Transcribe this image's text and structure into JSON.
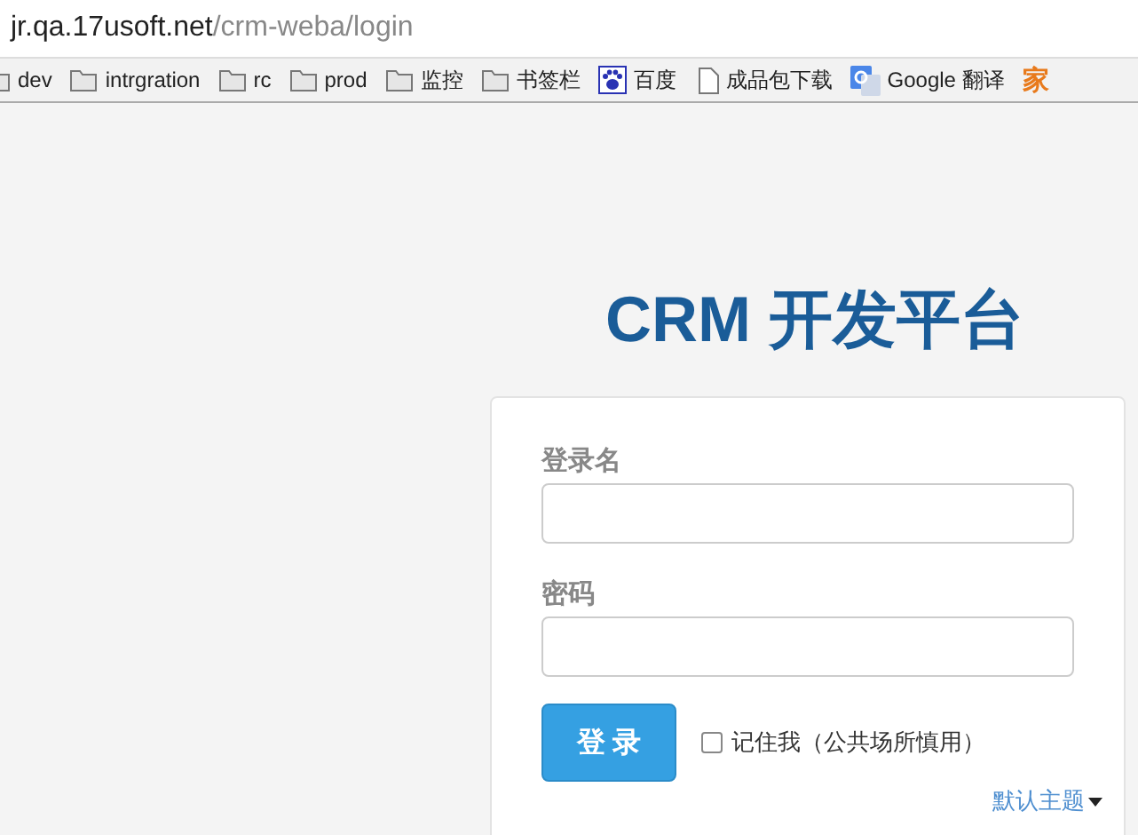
{
  "address_bar": {
    "host": "jr.qa.17usoft.net",
    "path": "/crm-weba/login"
  },
  "bookmarks": [
    {
      "kind": "folder",
      "label": "dev"
    },
    {
      "kind": "folder",
      "label": "intrgration"
    },
    {
      "kind": "folder",
      "label": "rc"
    },
    {
      "kind": "folder",
      "label": "prod"
    },
    {
      "kind": "folder",
      "label": "监控"
    },
    {
      "kind": "folder",
      "label": "书签栏"
    },
    {
      "kind": "paw",
      "label": "百度"
    },
    {
      "kind": "page",
      "label": "成品包下载"
    },
    {
      "kind": "translate",
      "label": "Google 翻译"
    },
    {
      "kind": "glyph",
      "label": "家"
    }
  ],
  "title": "CRM 开发平台",
  "login_form": {
    "username_label": "登录名",
    "password_label": "密码",
    "submit": "登 录",
    "remember": {
      "label": "记住我（公共场所慎用）",
      "checked": false
    },
    "theme_menu": "默认主题"
  }
}
